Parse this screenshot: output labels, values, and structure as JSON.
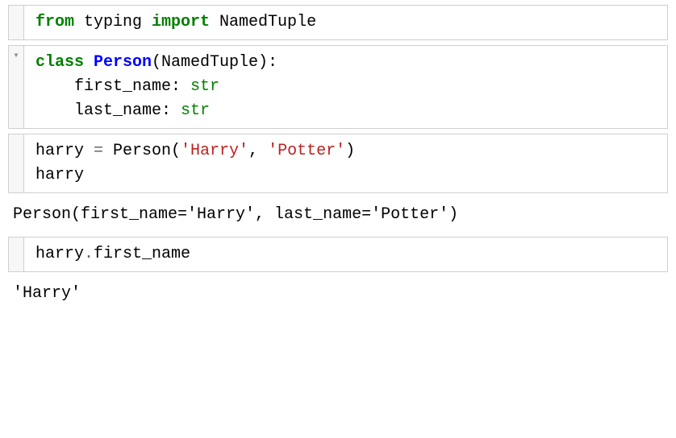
{
  "cells": [
    {
      "tokens": [
        {
          "t": "from ",
          "c": "kw-green"
        },
        {
          "t": "typing ",
          "c": "plain"
        },
        {
          "t": "import ",
          "c": "kw-green"
        },
        {
          "t": "NamedTuple",
          "c": "plain"
        }
      ],
      "collapsible": false,
      "output": null
    },
    {
      "tokens": [
        {
          "t": "class ",
          "c": "kw-green"
        },
        {
          "t": "Person",
          "c": "cls-blue"
        },
        {
          "t": "(NamedTuple):",
          "c": "plain"
        },
        {
          "t": "\n    first_name: ",
          "c": "plain"
        },
        {
          "t": "str",
          "c": "type-green"
        },
        {
          "t": "\n    last_name: ",
          "c": "plain"
        },
        {
          "t": "str",
          "c": "type-green"
        }
      ],
      "collapsible": true,
      "output": null
    },
    {
      "tokens": [
        {
          "t": "harry ",
          "c": "plain"
        },
        {
          "t": "= ",
          "c": "op"
        },
        {
          "t": "Person(",
          "c": "plain"
        },
        {
          "t": "'Harry'",
          "c": "str-red"
        },
        {
          "t": ", ",
          "c": "plain"
        },
        {
          "t": "'Potter'",
          "c": "str-red"
        },
        {
          "t": ")",
          "c": "plain"
        },
        {
          "t": "\nharry",
          "c": "plain"
        }
      ],
      "collapsible": false,
      "output": "Person(first_name='Harry', last_name='Potter')"
    },
    {
      "tokens": [
        {
          "t": "harry",
          "c": "plain"
        },
        {
          "t": ".",
          "c": "op"
        },
        {
          "t": "first_name",
          "c": "plain"
        }
      ],
      "collapsible": false,
      "output": "'Harry'"
    }
  ],
  "arrow": "▾"
}
